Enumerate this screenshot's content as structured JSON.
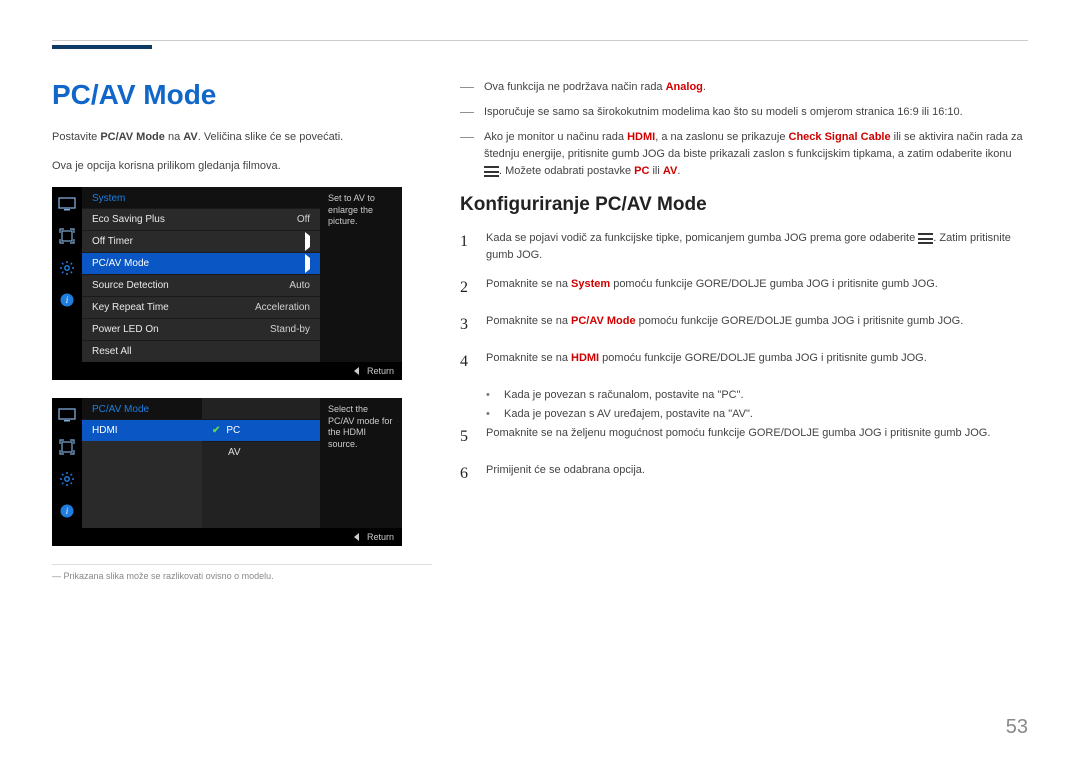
{
  "page_number": "53",
  "title": "PC/AV Mode",
  "intro_p1_pre": "Postavite ",
  "intro_p1_b1": "PC/AV Mode",
  "intro_p1_mid": " na ",
  "intro_p1_b2": "AV",
  "intro_p1_post": ". Veličina slike će se povećati.",
  "intro_p2": "Ova je opcija korisna prilikom gledanja filmova.",
  "dash1_pre": "Ova funkcija ne podržava način rada ",
  "dash1_b": "Analog",
  "dash1_post": ".",
  "dash2": "Isporučuje se samo sa širokokutnim modelima kao što su modeli s omjerom stranica 16:9 ili 16:10.",
  "dash3_pre": "Ako je monitor u načinu rada ",
  "dash3_b1": "HDMI",
  "dash3_mid1": ", a na zaslonu se prikazuje ",
  "dash3_b2": "Check Signal Cable",
  "dash3_mid2": " ili se aktivira način rada za štednju energije, pritisnite gumb JOG da biste prikazali zaslon s funkcijskim tipkama, a zatim odaberite ikonu ",
  "dash3_post1": ". Možete odabrati postavke ",
  "dash3_b3": "PC",
  "dash3_or": " ili ",
  "dash3_b4": "AV",
  "dash3_post2": ".",
  "subhead": "Konfiguriranje PC/AV Mode",
  "step1_pre": "Kada se pojavi vodič za funkcijske tipke, pomicanjem gumba JOG prema gore odaberite ",
  "step1_post": ". Zatim pritisnite gumb JOG.",
  "step2_pre": "Pomaknite se na ",
  "step2_b": "System",
  "step2_post": " pomoću funkcije GORE/DOLJE gumba JOG i pritisnite gumb JOG.",
  "step3_pre": "Pomaknite se na ",
  "step3_b": "PC/AV Mode",
  "step3_post": " pomoću funkcije GORE/DOLJE gumba JOG i pritisnite gumb JOG.",
  "step4_pre": "Pomaknite se na ",
  "step4_b": "HDMI",
  "step4_post": " pomoću funkcije GORE/DOLJE gumba JOG i pritisnite gumb JOG.",
  "step4_dot1": "Kada je povezan s računalom, postavite na \"PC\".",
  "step4_dot2": "Kada je povezan s AV uređajem, postavite na \"AV\".",
  "step5": "Pomaknite se na željenu mogućnost pomoću funkcije GORE/DOLJE gumba JOG i pritisnite gumb JOG.",
  "step6": "Primijenit će se odabrana opcija.",
  "footnote_pre": "― ",
  "footnote": "Prikazana slika može se razlikovati ovisno o modelu.",
  "osd1": {
    "head": "System",
    "desc": "Set to AV to enlarge the picture.",
    "rows": [
      {
        "label": "Eco Saving Plus",
        "val": "Off"
      },
      {
        "label": "Off Timer",
        "val": "▶"
      },
      {
        "label": "PC/AV Mode",
        "val": "▶",
        "sel": true
      },
      {
        "label": "Source Detection",
        "val": "Auto"
      },
      {
        "label": "Key Repeat Time",
        "val": "Acceleration"
      },
      {
        "label": "Power LED On",
        "val": "Stand-by"
      },
      {
        "label": "Reset All",
        "val": ""
      }
    ],
    "return": "Return"
  },
  "osd2": {
    "head": "PC/AV Mode",
    "desc": "Select the PC/AV mode for the HDMI source.",
    "left_rows": [
      {
        "label": "HDMI",
        "sel": true
      }
    ],
    "right_rows": [
      {
        "label": "PC",
        "sel": true,
        "check": true
      },
      {
        "label": "AV"
      }
    ],
    "return": "Return"
  }
}
